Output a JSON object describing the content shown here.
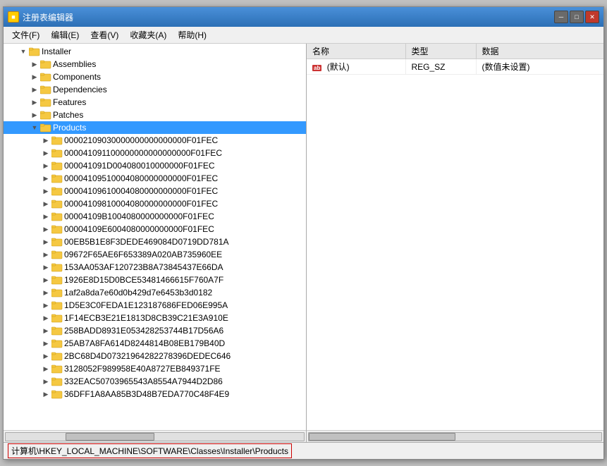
{
  "window": {
    "title": "注册表编辑器",
    "icon": "■"
  },
  "title_buttons": {
    "minimize": "─",
    "restore": "□",
    "close": "✕"
  },
  "menu": {
    "items": [
      "文件(F)",
      "编辑(E)",
      "查看(V)",
      "收藏夹(A)",
      "帮助(H)"
    ]
  },
  "tree": {
    "root_nodes": [
      {
        "id": "installer",
        "label": "Installer",
        "indent": 1,
        "expanded": true,
        "selected": false
      },
      {
        "id": "assemblies",
        "label": "Assemblies",
        "indent": 2,
        "expanded": false,
        "selected": false
      },
      {
        "id": "components",
        "label": "Components",
        "indent": 2,
        "expanded": false,
        "selected": false
      },
      {
        "id": "dependencies",
        "label": "Dependencies",
        "indent": 2,
        "expanded": false,
        "selected": false
      },
      {
        "id": "features",
        "label": "Features",
        "indent": 2,
        "expanded": false,
        "selected": false
      },
      {
        "id": "patches",
        "label": "Patches",
        "indent": 2,
        "expanded": false,
        "selected": false
      },
      {
        "id": "products",
        "label": "Products",
        "indent": 2,
        "expanded": true,
        "selected": true
      },
      {
        "id": "k1",
        "label": "00002109030000000000000000F01FEC",
        "indent": 3,
        "selected": false
      },
      {
        "id": "k2",
        "label": "000041091100000000000000000F01FEC",
        "indent": 3,
        "selected": false
      },
      {
        "id": "k3",
        "label": "000041091D004080010000000F01FEC",
        "indent": 3,
        "selected": false
      },
      {
        "id": "k4",
        "label": "00004109510004080000000000F01FEC",
        "indent": 3,
        "selected": false
      },
      {
        "id": "k5",
        "label": "00004109610004080000000000F01FEC",
        "indent": 3,
        "selected": false
      },
      {
        "id": "k6",
        "label": "00004109810004080000000000F01FEC",
        "indent": 3,
        "selected": false
      },
      {
        "id": "k7",
        "label": "00004109B1004080000000000F01FEC",
        "indent": 3,
        "selected": false
      },
      {
        "id": "k8",
        "label": "00004109E6004080000000000F01FEC",
        "indent": 3,
        "selected": false
      },
      {
        "id": "k9",
        "label": "00EB5B1E8F3DEDE469084D0719DD781A",
        "indent": 3,
        "selected": false
      },
      {
        "id": "k10",
        "label": "09672F65AE6F653389A020AB735960EE",
        "indent": 3,
        "selected": false
      },
      {
        "id": "k11",
        "label": "153AA053AF120723B8A73845437E66DA",
        "indent": 3,
        "selected": false
      },
      {
        "id": "k12",
        "label": "1926E8D15D0BCE53481466615F760A7F",
        "indent": 3,
        "selected": false
      },
      {
        "id": "k13",
        "label": "1af2a8da7e60d0b429d7e6453b3d0182",
        "indent": 3,
        "selected": false
      },
      {
        "id": "k14",
        "label": "1D5E3C0FEDA1E123187686FED06E995A",
        "indent": 3,
        "selected": false
      },
      {
        "id": "k15",
        "label": "1F14ECB3E21E1813D8CB39C21E3A910E",
        "indent": 3,
        "selected": false
      },
      {
        "id": "k16",
        "label": "258BADD8931E053428253744B17D56A6",
        "indent": 3,
        "selected": false
      },
      {
        "id": "k17",
        "label": "25AB7A8FA614D8244814B08EB179B40D",
        "indent": 3,
        "selected": false
      },
      {
        "id": "k18",
        "label": "2BC68D4D07321964282278396DEDEC646",
        "indent": 3,
        "selected": false
      },
      {
        "id": "k19",
        "label": "3128052F989958E40A8727EB849371FE",
        "indent": 3,
        "selected": false
      },
      {
        "id": "k20",
        "label": "332EAC50703965543A8554A7944D2D86",
        "indent": 3,
        "selected": false
      },
      {
        "id": "k21",
        "label": "36DFF1A8AA85B3D48B7EDA770C48F4E9",
        "indent": 3,
        "selected": false
      }
    ]
  },
  "right_panel": {
    "columns": [
      "名称",
      "类型",
      "数据"
    ],
    "rows": [
      {
        "icon": "ab",
        "name": "(默认)",
        "type": "REG_SZ",
        "data": "(数值未设置)"
      }
    ]
  },
  "status_bar": {
    "text": "计算机\\HKEY_LOCAL_MACHINE\\SOFTWARE\\Classes\\Installer\\Products"
  }
}
